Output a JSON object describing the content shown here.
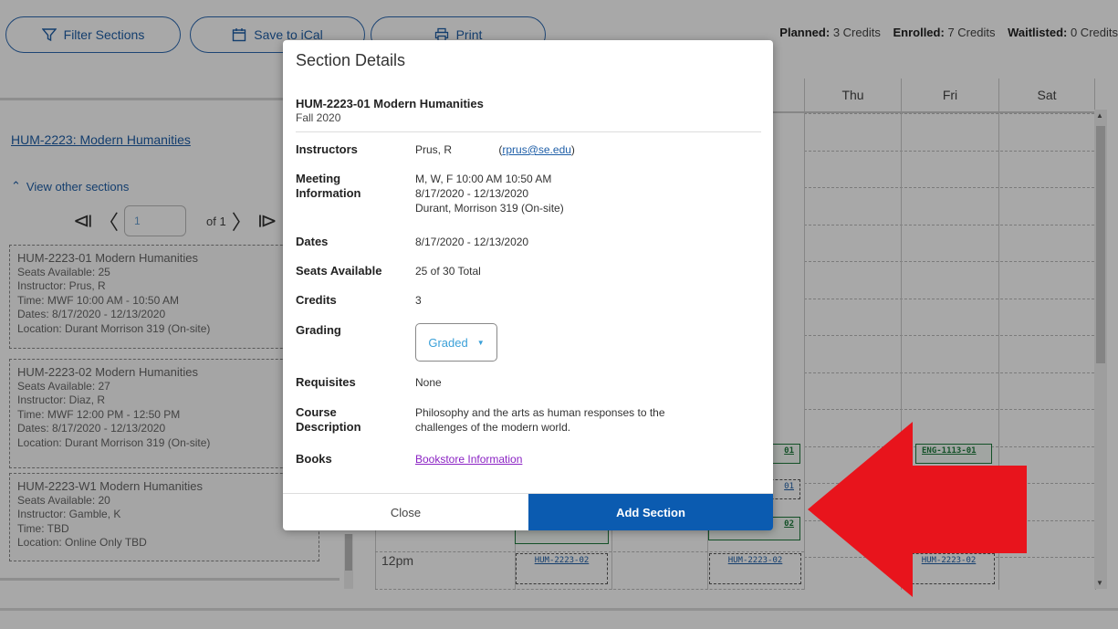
{
  "toolbar": {
    "filter_label": "Filter Sections",
    "save_label": "Save to iCal",
    "print_label": "Print",
    "planned_label": "Planned:",
    "planned_value": "3 Credits",
    "enrolled_label": "Enrolled:",
    "enrolled_value": "7 Credits",
    "waitlisted_label": "Waitlisted:",
    "waitlisted_value": "0 Credits"
  },
  "left_panel": {
    "course_link": "HUM-2223: Modern Humanities",
    "view_other": "View other sections",
    "pager_value": "1",
    "pager_of": "of 1",
    "sections": [
      {
        "title": "HUM-2223-01 Modern Humanities",
        "seats": "Seats Available: 25",
        "instructor": "Instructor: Prus, R",
        "time": "Time: MWF 10:00 AM - 10:50 AM",
        "dates": "Dates: 8/17/2020 - 12/13/2020",
        "location": "Location: Durant Morrison 319 (On-site)"
      },
      {
        "title": "HUM-2223-02 Modern Humanities",
        "seats": "Seats Available: 27",
        "instructor": "Instructor: Diaz, R",
        "time": "Time: MWF 12:00 PM - 12:50 PM",
        "dates": "Dates: 8/17/2020 - 12/13/2020",
        "location": "Location: Durant Morrison 319 (On-site)"
      },
      {
        "title": "HUM-2223-W1 Modern Humanities",
        "seats": "Seats Available: 20",
        "instructor": "Instructor: Gamble, K",
        "time": "Time: TBD",
        "location": "Location: Online Only TBD"
      }
    ]
  },
  "calendar": {
    "days": [
      "Thu",
      "Fri",
      "Sat"
    ],
    "time_label": "12pm",
    "events": {
      "eng_fri": "ENG-1113-01",
      "partial_01a": "01",
      "partial_01b": "01",
      "partial_02": "02",
      "hum_tue": "HUM-2223-02",
      "hum_wed": "HUM-2223-02",
      "hum_fri": "HUM-2223-02"
    }
  },
  "modal": {
    "title": "Section Details",
    "course": "HUM-2223-01 Modern Humanities",
    "term": "Fall 2020",
    "instructors_label": "Instructors",
    "instructor_name": "Prus, R",
    "instructor_email": "rprus@se.edu",
    "meeting_label_1": "Meeting",
    "meeting_label_2": "Information",
    "meeting_line1": "M, W, F 10:00 AM 10:50 AM",
    "meeting_line2": "8/17/2020 - 12/13/2020",
    "meeting_line3": "Durant, Morrison 319 (On-site)",
    "dates_label": "Dates",
    "dates_value": "8/17/2020 - 12/13/2020",
    "seats_label": "Seats Available",
    "seats_value": "25 of 30 Total",
    "credits_label": "Credits",
    "credits_value": "3",
    "grading_label": "Grading",
    "grading_value": "Graded",
    "requisites_label": "Requisites",
    "requisites_value": "None",
    "desc_label_1": "Course",
    "desc_label_2": "Description",
    "desc_line1": "Philosophy and the arts as human responses to the",
    "desc_line2": "challenges of the modern world.",
    "books_label": "Books",
    "books_link": "Bookstore Information",
    "close_label": "Close",
    "add_label": "Add Section"
  },
  "colors": {
    "accent": "#0b5bb0",
    "arrow": "#e8141c",
    "enrolled_green": "#1e7a3c"
  }
}
